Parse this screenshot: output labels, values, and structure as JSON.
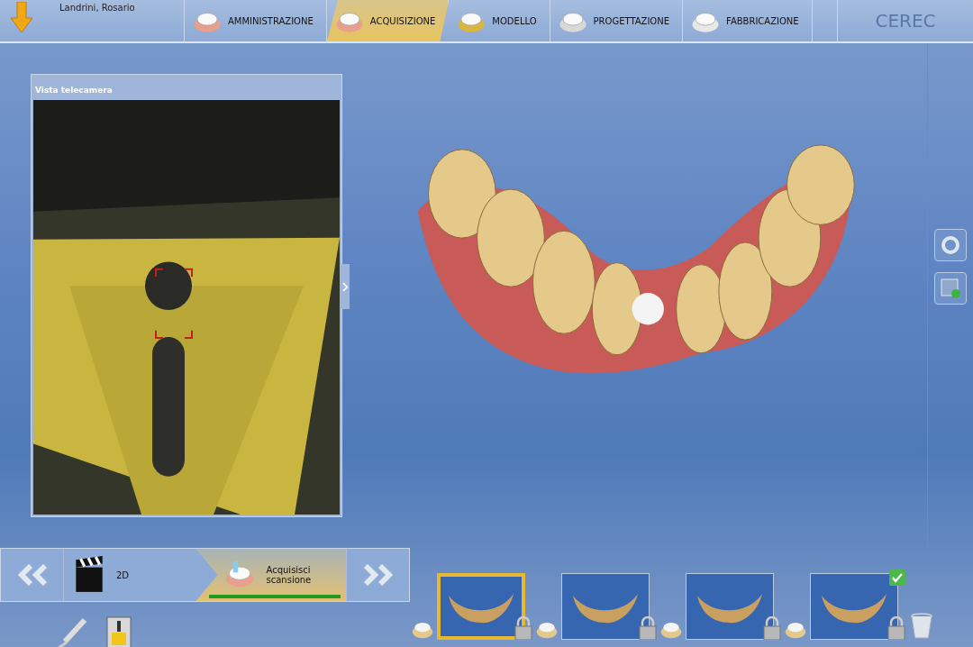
{
  "header": {
    "patient_name": "Landrini, Rosario",
    "brand": "CEREC"
  },
  "steps": [
    {
      "label": "AMMINISTRAZIONE",
      "selected": false
    },
    {
      "label": "ACQUISIZIONE",
      "selected": true
    },
    {
      "label": "MODELLO",
      "selected": false
    },
    {
      "label": "PROGETTAZIONE",
      "selected": false
    },
    {
      "label": "FABBRICAZIONE",
      "selected": false
    }
  ],
  "camera_panel": {
    "title": "Vista telecamera"
  },
  "substeps": [
    {
      "label": "2D",
      "kind": "clapper",
      "selected": false
    },
    {
      "label": "Acquisisci scansione",
      "kind": "scan",
      "selected": true,
      "level": 1
    }
  ],
  "catalogs": [
    {
      "selected": true,
      "checked": false
    },
    {
      "selected": false,
      "checked": false
    },
    {
      "selected": false,
      "checked": false
    },
    {
      "selected": false,
      "checked": true
    }
  ]
}
